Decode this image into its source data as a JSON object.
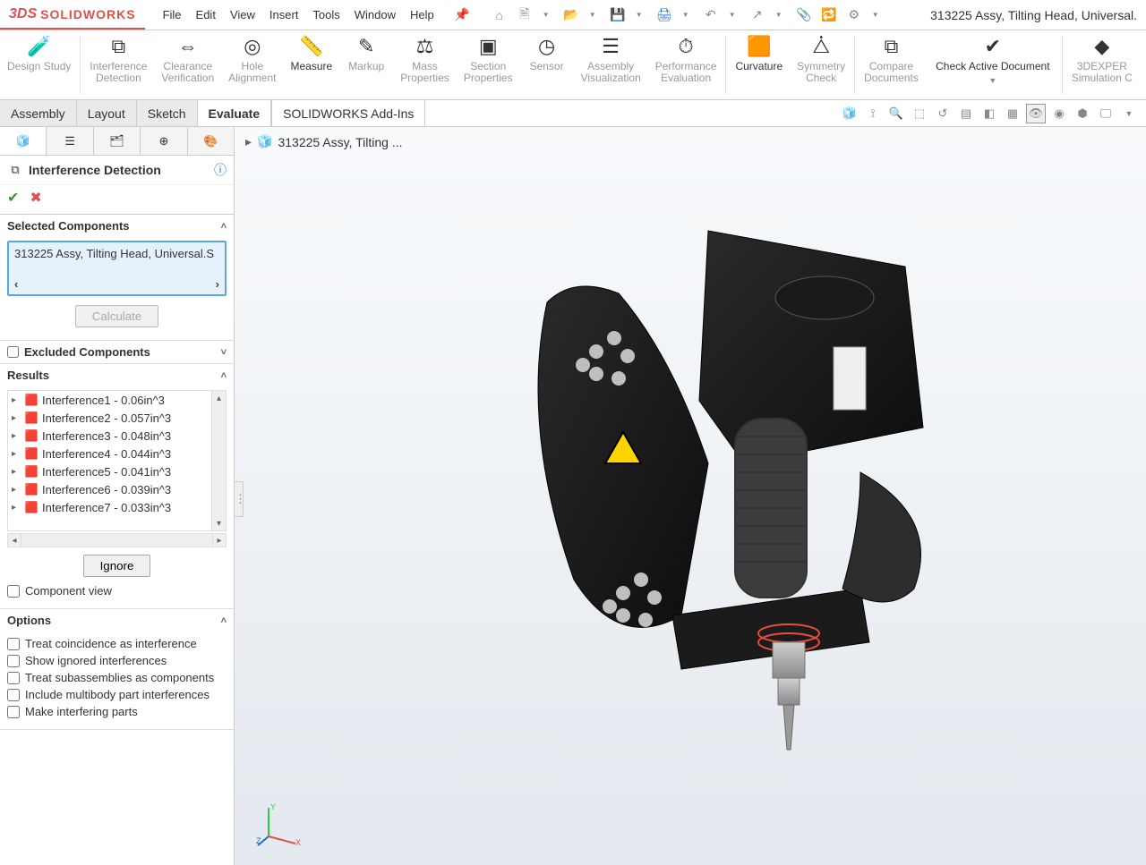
{
  "app": {
    "logo_prefix": "3DS",
    "logo_text": "SOLIDWORKS"
  },
  "menu": {
    "items": [
      "File",
      "Edit",
      "View",
      "Insert",
      "Tools",
      "Window",
      "Help"
    ]
  },
  "document_title": "313225 Assy, Tilting Head, Universal.",
  "ribbon": {
    "groups": [
      {
        "label": "Design Study",
        "icon": "design-study-icon",
        "active": false
      },
      {
        "label": "Interference\nDetection",
        "icon": "interference-icon",
        "active": false
      },
      {
        "label": "Clearance\nVerification",
        "icon": "clearance-icon",
        "active": false
      },
      {
        "label": "Hole\nAlignment",
        "icon": "hole-align-icon",
        "active": false
      },
      {
        "label": "Measure",
        "icon": "measure-icon",
        "active": true
      },
      {
        "label": "Markup",
        "icon": "markup-icon",
        "active": false
      },
      {
        "label": "Mass\nProperties",
        "icon": "mass-prop-icon",
        "active": false
      },
      {
        "label": "Section\nProperties",
        "icon": "section-prop-icon",
        "active": false
      },
      {
        "label": "Sensor",
        "icon": "sensor-icon",
        "active": false
      },
      {
        "label": "Assembly\nVisualization",
        "icon": "assy-vis-icon",
        "active": false
      },
      {
        "label": "Performance\nEvaluation",
        "icon": "perf-eval-icon",
        "active": false
      },
      {
        "label": "Curvature",
        "icon": "curvature-icon",
        "active": true
      },
      {
        "label": "Symmetry\nCheck",
        "icon": "symmetry-icon",
        "active": false
      },
      {
        "label": "Compare\nDocuments",
        "icon": "compare-icon",
        "active": false
      },
      {
        "label": "Check Active Document",
        "icon": "check-doc-icon",
        "active": true,
        "dropdown": true
      },
      {
        "label": "3DEXPER\nSimulation C",
        "icon": "3dexp-icon",
        "active": false
      }
    ]
  },
  "tabs": {
    "items": [
      "Assembly",
      "Layout",
      "Sketch",
      "Evaluate",
      "SOLIDWORKS Add-Ins"
    ],
    "active": "Evaluate"
  },
  "sidebar": {
    "pm_title": "Interference Detection",
    "selected_header": "Selected Components",
    "selected_value": "313225 Assy, Tilting Head, Universal.S",
    "calculate_label": "Calculate",
    "excluded_header": "Excluded Components",
    "results_header": "Results",
    "results": [
      "Interference1 - 0.06in^3",
      "Interference2 - 0.057in^3",
      "Interference3 - 0.048in^3",
      "Interference4 - 0.044in^3",
      "Interference5 - 0.041in^3",
      "Interference6 - 0.039in^3",
      "Interference7 - 0.033in^3"
    ],
    "ignore_label": "Ignore",
    "component_view_label": "Component view",
    "options_header": "Options",
    "options": [
      "Treat coincidence as interference",
      "Show ignored interferences",
      "Treat subassemblies as components",
      "Include multibody part interferences",
      "Make interfering parts"
    ]
  },
  "breadcrumb": "313225 Assy, Tilting ..."
}
